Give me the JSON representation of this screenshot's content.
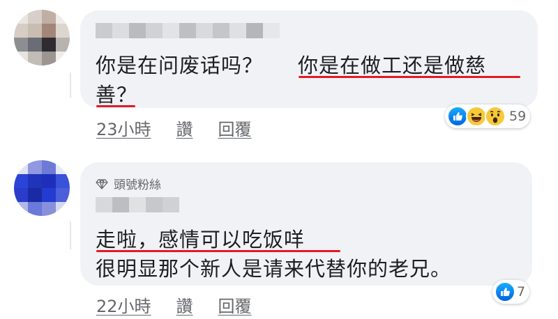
{
  "comments": [
    {
      "line1_plain": "你是在问废话吗？",
      "line1_marked": "你是在做工还是做慈",
      "line2_marked": "善？",
      "reaction_count": "59",
      "reactions": [
        "like-icon",
        "haha-icon",
        "wow-icon"
      ],
      "time": "23小時",
      "like_action": "讚",
      "reply_action": "回覆"
    },
    {
      "badge": "頭號粉絲",
      "line1_marked": "走啦，感情可以吃饭咩",
      "line2": "很明显那个新人是请来代替你的老兄。",
      "reaction_count": "7",
      "reactions": [
        "like-icon"
      ],
      "time": "22小時",
      "like_action": "讚",
      "reply_action": "回覆"
    }
  ],
  "colors": {
    "bubble": "#f0f2f5",
    "underline": "#e01a2a",
    "meta_text": "#65676b",
    "like_blue": "#0866ff"
  }
}
